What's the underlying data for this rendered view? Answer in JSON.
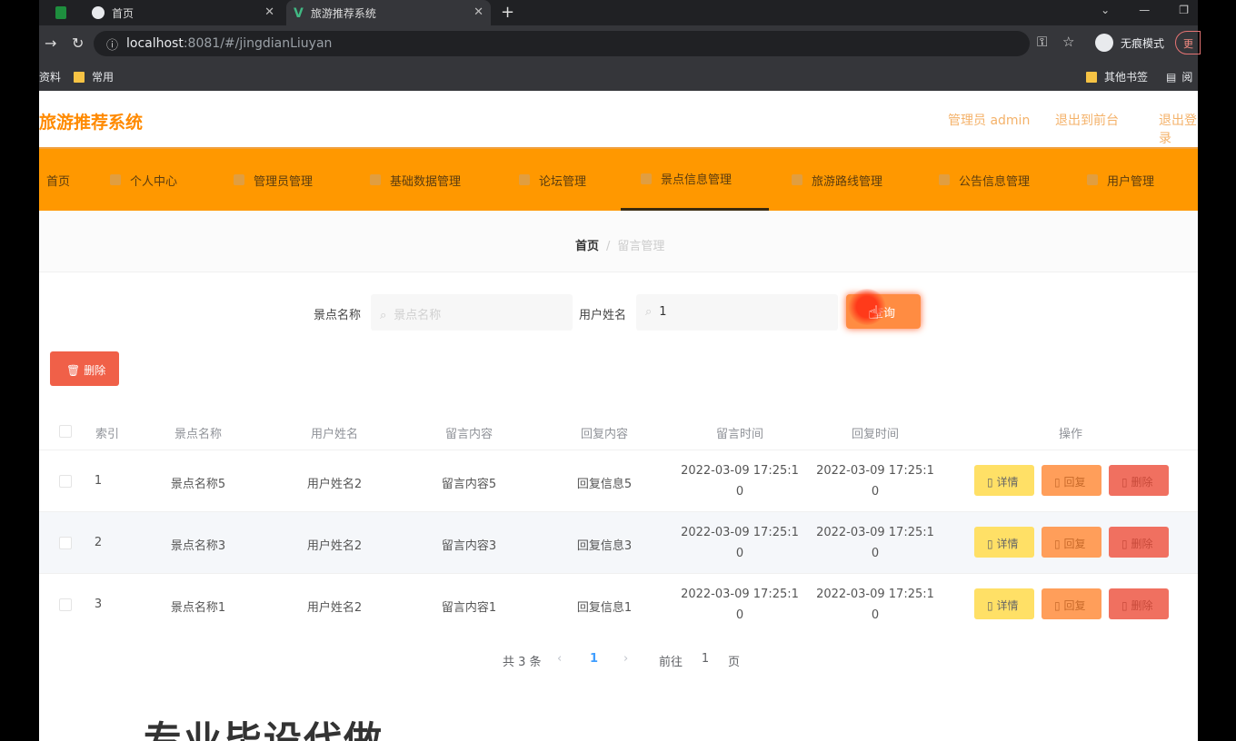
{
  "browser": {
    "tabs": [
      {
        "label": "首页"
      },
      {
        "label": "旅游推荐系统"
      }
    ],
    "url_host": "localhost",
    "url_rest": ":8081/#/jingdianLiuyan",
    "incognito_label": "无痕模式",
    "update_label": "更",
    "bookmarks": {
      "left1": "资料",
      "left2": "常用",
      "right1": "其他书签",
      "right2": "阅"
    }
  },
  "header": {
    "brand": "旅游推荐系统",
    "admin": "管理员 admin",
    "back_label": "退出到前台",
    "logout_label": "退出登录"
  },
  "menu": [
    {
      "label": "首页"
    },
    {
      "label": "个人中心"
    },
    {
      "label": "管理员管理"
    },
    {
      "label": "基础数据管理"
    },
    {
      "label": "论坛管理"
    },
    {
      "label": "景点信息管理"
    },
    {
      "label": "旅游路线管理"
    },
    {
      "label": "公告信息管理"
    },
    {
      "label": "用户管理"
    }
  ],
  "breadcrumb": {
    "home": "首页",
    "separator": "/",
    "current": "留言管理"
  },
  "search": {
    "scenic_label": "景点名称",
    "scenic_placeholder": "景点名称",
    "user_label": "用户姓名",
    "user_value": "1",
    "search_button": "查询"
  },
  "delete_button": "删除",
  "table": {
    "headers": [
      "索引",
      "景点名称",
      "用户姓名",
      "留言内容",
      "回复内容",
      "留言时间",
      "回复时间",
      "操作"
    ],
    "rows": [
      {
        "index": "1",
        "scenic": "景点名称5",
        "user": "用户姓名2",
        "content": "留言内容5",
        "reply": "回复信息5",
        "time1": "2022-03-09 17:25:1",
        "time1b": "0",
        "time2": "2022-03-09 17:25:1",
        "time2b": "0"
      },
      {
        "index": "2",
        "scenic": "景点名称3",
        "user": "用户姓名2",
        "content": "留言内容3",
        "reply": "回复信息3",
        "time1": "2022-03-09 17:25:1",
        "time1b": "0",
        "time2": "2022-03-09 17:25:1",
        "time2b": "0"
      },
      {
        "index": "3",
        "scenic": "景点名称1",
        "user": "用户姓名2",
        "content": "留言内容1",
        "reply": "回复信息1",
        "time1": "2022-03-09 17:25:1",
        "time1b": "0",
        "time2": "2022-03-09 17:25:1",
        "time2b": "0"
      }
    ],
    "actions": {
      "detail": "详情",
      "reply": "回复",
      "delete": "删除"
    }
  },
  "pagination": {
    "total": "共 3 条",
    "prev": "‹",
    "page": "1",
    "next": "›",
    "goto": "前往",
    "goto_value": "1",
    "page_suffix": "页"
  },
  "banner_text": "专业毕设代做"
}
